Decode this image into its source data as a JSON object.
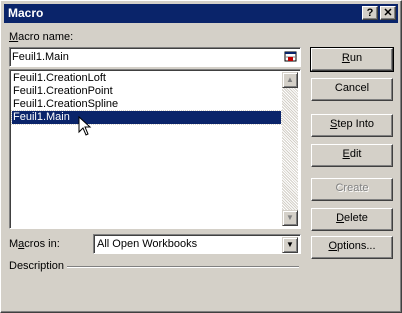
{
  "window": {
    "title": "Macro",
    "help_label": "?",
    "close_label": "✕"
  },
  "macro_name": {
    "label_hotkey": "M",
    "label_rest": "acro name:",
    "value": "Feuil1.Main",
    "icon": "select-range-icon"
  },
  "macro_list": {
    "items": [
      {
        "label": "Feuil1.CreationLoft"
      },
      {
        "label": "Feuil1.CreationPoint"
      },
      {
        "label": "Feuil1.CreationSpline"
      },
      {
        "label": "Feuil1.Main"
      }
    ],
    "selected_index": 3
  },
  "buttons": {
    "run": {
      "hotkey": "R",
      "rest": "un"
    },
    "cancel": {
      "label": "Cancel"
    },
    "step_into": {
      "hotkey": "S",
      "rest": "tep Into"
    },
    "edit": {
      "hotkey": "E",
      "rest": "dit"
    },
    "create": {
      "label": "Create"
    },
    "delete": {
      "hotkey": "D",
      "rest": "elete"
    },
    "options": {
      "hotkey": "O",
      "rest": "ptions..."
    }
  },
  "macros_in": {
    "label_start": "M",
    "label_hotkey": "a",
    "label_rest": "cros in:",
    "value": "All Open Workbooks"
  },
  "description": {
    "label": "Description"
  },
  "colors": {
    "face": "#d4d0c8",
    "titlebar": "#0a246a",
    "selection": "#0a246a"
  }
}
